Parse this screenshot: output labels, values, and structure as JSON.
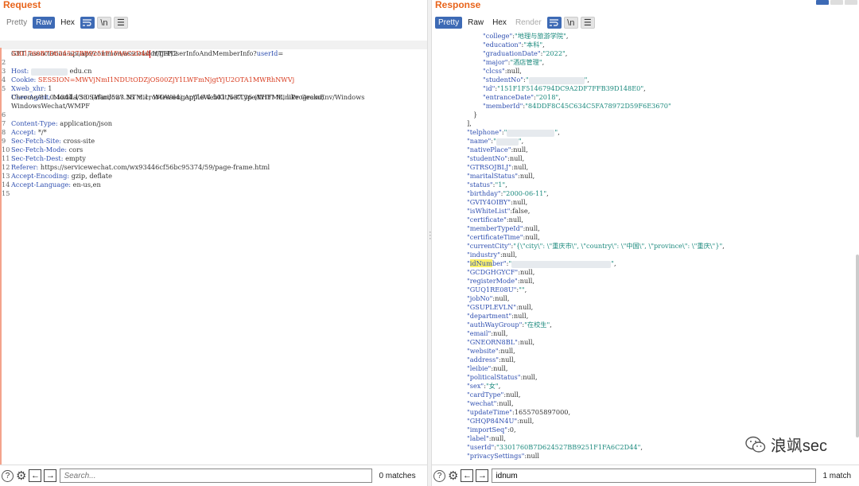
{
  "request": {
    "title": "Request",
    "tabs": {
      "pretty": "Pretty",
      "raw": "Raw",
      "hex": "Hex"
    },
    "wrap_icon": "wrap-icon",
    "newline_label": "\\n",
    "menu_icon": "menu-icon",
    "lines": {
      "n1": "1",
      "l1": "GET /association-api/api/common/associator/getUserInfoAndMemberInfo?",
      "l1_param": "userId",
      "l1_eq": "=",
      "l1b": "3301760B7D624527BB9251F1FA6C2D44",
      "l1b_rest": " HTTP/2",
      "n2": "2",
      "l2_key": "Host: ",
      "l2_val": "edu.cn",
      "n3": "3",
      "l3_key": "Cookie: ",
      "l3_val": "SESSION=MWVjNmI1NDUtODZjOS00ZjY1LWFmNjgtYjU2OTA1MWRhNWVj",
      "n4": "4",
      "l4_key": "Xweb_xhr: ",
      "l4_val": "1",
      "n5": "5",
      "l5_key": "User-Agent: ",
      "l5_val": "Mozilla/5.0 (Windows NT 6.1; WOW64) AppleWebKit/537.36 (KHTML, like Gecko)",
      "l5b": "Chrome/81.0.4044.138 Safari/537.36 MicroMessenger/7.0.4.501 NetType/WIFI MiniProgramEnv/Windows",
      "l5c": "WindowsWechat/WMPF",
      "n6": "6",
      "l6_key": "Content-Type: ",
      "l6_val": "application/json",
      "n7": "7",
      "l7_key": "Accept: ",
      "l7_val": "*/*",
      "n8": "8",
      "l8_key": "Sec-Fetch-Site: ",
      "l8_val": "cross-site",
      "n9": "9",
      "l9_key": "Sec-Fetch-Mode: ",
      "l9_val": "cors",
      "n10": "10",
      "l10_key": "Sec-Fetch-Dest: ",
      "l10_val": "empty",
      "n11": "11",
      "l11_key": "Referer: ",
      "l11_val": "https://servicewechat.com/wx93446cf56bc95374/59/page-frame.html",
      "n12": "12",
      "l12_key": "Accept-Encoding: ",
      "l12_val": "gzip, deflate",
      "n13": "13",
      "l13_key": "Accept-Language: ",
      "l13_val": "en-us,en",
      "n14": "14",
      "n15": "15"
    },
    "search": {
      "placeholder": "Search...",
      "value": "",
      "matches": "0 matches"
    }
  },
  "response": {
    "title": "Response",
    "tabs": {
      "pretty": "Pretty",
      "raw": "Raw",
      "hex": "Hex",
      "render": "Render"
    },
    "newline_label": "\\n",
    "json_lines": [
      {
        "k": "\"college\"",
        "sep": ":",
        "v": "\"地理与旅游学院\"",
        "end": ","
      },
      {
        "k": "\"education\"",
        "sep": ":",
        "v": "\"本科\"",
        "end": ","
      },
      {
        "k": "\"graduationDate\"",
        "sep": ":",
        "v": "\"2022\"",
        "end": ","
      },
      {
        "k": "\"major\"",
        "sep": ":",
        "v": "\"酒店管理\"",
        "end": ","
      },
      {
        "k": "\"clcss\"",
        "sep": ":",
        "v": "null",
        "end": ","
      },
      {
        "k": "\"studentNo\"",
        "sep": ":",
        "v": "\"",
        "end": ","
      },
      {
        "k": "\"id\"",
        "sep": ":",
        "v": "\"151F1F5146794DC9A2DF7FFB39D148E0\"",
        "end": ","
      },
      {
        "k": "\"entranceDate\"",
        "sep": ":",
        "v": "\"2018\"",
        "end": ","
      },
      {
        "k": "\"memberId\"",
        "sep": ":",
        "v": "\"84DDF8C45C634C5FA78972D59F6E3670\"",
        "end": ""
      },
      {
        "k": "}",
        "sep": "",
        "v": "",
        "end": ""
      },
      {
        "k": "],",
        "sep": "",
        "v": "",
        "end": ""
      },
      {
        "k": "\"telphone\"",
        "sep": ":",
        "v": "\"",
        "end": ","
      },
      {
        "k": "\"name\"",
        "sep": ":",
        "v": "\"",
        "end": ","
      },
      {
        "k": "\"nativePlace\"",
        "sep": ":",
        "v": "null",
        "end": ","
      },
      {
        "k": "\"studentNo\"",
        "sep": ":",
        "v": "null",
        "end": ","
      },
      {
        "k": "\"GTRSOJBLJ\"",
        "sep": ":",
        "v": "null",
        "end": ","
      },
      {
        "k": "\"maritalStatus\"",
        "sep": ":",
        "v": "null",
        "end": ","
      },
      {
        "k": "\"status\"",
        "sep": ":",
        "v": "\"1\"",
        "end": ","
      },
      {
        "k": "\"birthday\"",
        "sep": ":",
        "v": "\"2000-06-11\"",
        "end": ","
      },
      {
        "k": "\"GVIY4OIBY\"",
        "sep": ":",
        "v": "null",
        "end": ","
      },
      {
        "k": "\"isWhiteList\"",
        "sep": ":",
        "v": "false",
        "end": ","
      },
      {
        "k": "\"certificate\"",
        "sep": ":",
        "v": "null",
        "end": ","
      },
      {
        "k": "\"memberTypeId\"",
        "sep": ":",
        "v": "null",
        "end": ","
      },
      {
        "k": "\"certificateTime\"",
        "sep": ":",
        "v": "null",
        "end": ","
      },
      {
        "k": "\"currentCity\"",
        "sep": ":",
        "v": "\"{\\\"city\\\": \\\"重庆市\\\", \\\"country\\\": \\\"中国\\\", \\\"province\\\": \\\"重庆\\\"}\"",
        "end": ","
      },
      {
        "k": "\"industry\"",
        "sep": ":",
        "v": "null",
        "end": ","
      },
      {
        "k": "\"idNumber\"",
        "sep": ":",
        "v": "\"",
        "end": ","
      },
      {
        "k": "\"GCDGHGYCF\"",
        "sep": ":",
        "v": "null",
        "end": ","
      },
      {
        "k": "\"registerMode\"",
        "sep": ":",
        "v": "null",
        "end": ","
      },
      {
        "k": "\"GUQ1RE08U\"",
        "sep": ":",
        "v": "\"\"",
        "end": ","
      },
      {
        "k": "\"jobNo\"",
        "sep": ":",
        "v": "null",
        "end": ","
      },
      {
        "k": "\"GSUPLEVLN\"",
        "sep": ":",
        "v": "null",
        "end": ","
      },
      {
        "k": "\"department\"",
        "sep": ":",
        "v": "null",
        "end": ","
      },
      {
        "k": "\"authWayGroup\"",
        "sep": ":",
        "v": "\"在校生\"",
        "end": ","
      },
      {
        "k": "\"email\"",
        "sep": ":",
        "v": "null",
        "end": ","
      },
      {
        "k": "\"GNEORN8BL\"",
        "sep": ":",
        "v": "null",
        "end": ","
      },
      {
        "k": "\"website\"",
        "sep": ":",
        "v": "null",
        "end": ","
      },
      {
        "k": "\"address\"",
        "sep": ":",
        "v": "null",
        "end": ","
      },
      {
        "k": "\"leibie\"",
        "sep": ":",
        "v": "null",
        "end": ","
      },
      {
        "k": "\"politicalStatus\"",
        "sep": ":",
        "v": "null",
        "end": ","
      },
      {
        "k": "\"sex\"",
        "sep": ":",
        "v": "\"女\"",
        "end": ","
      },
      {
        "k": "\"cardType\"",
        "sep": ":",
        "v": "null",
        "end": ","
      },
      {
        "k": "\"wechat\"",
        "sep": ":",
        "v": "null",
        "end": ","
      },
      {
        "k": "\"updateTime\"",
        "sep": ":",
        "v": "1655705897000",
        "end": ","
      },
      {
        "k": "\"GHQP84N4U\"",
        "sep": ":",
        "v": "null",
        "end": ","
      },
      {
        "k": "\"importSeq\"",
        "sep": ":",
        "v": "0",
        "end": ","
      },
      {
        "k": "\"label\"",
        "sep": ":",
        "v": "null",
        "end": ","
      },
      {
        "k": "\"userId\"",
        "sep": ":",
        "v": "\"3301760B7D624527BB9251F1FA6C2D44\"",
        "end": ","
      },
      {
        "k": "\"privacySettings\"",
        "sep": ":",
        "v": "null",
        "end": ""
      }
    ],
    "search": {
      "placeholder": "",
      "value": "idnum",
      "matches": "1 match"
    }
  },
  "watermark": {
    "text": "浪飒sec",
    "icon": "wechat-icon"
  }
}
